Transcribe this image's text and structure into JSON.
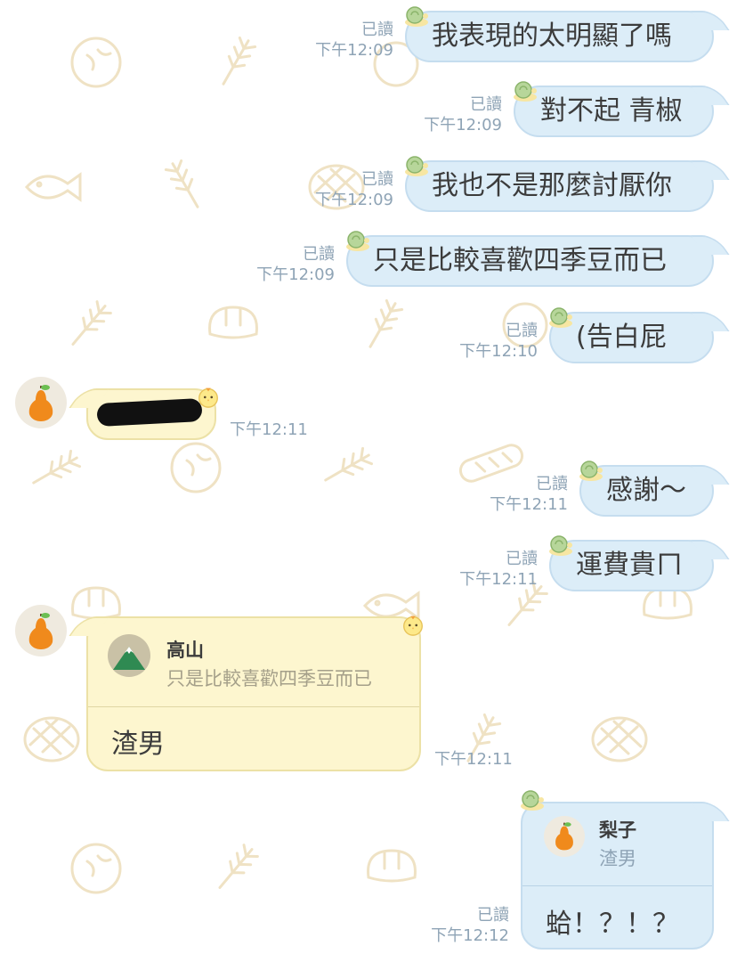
{
  "colors": {
    "outgoing_bubble": "#dcedf8",
    "incoming_bubble": "#fdf6cf",
    "meta_text": "#8fa4b6",
    "background_doodles": "#efe2c4"
  },
  "messages": [
    {
      "text": "我表現的太明顯了嗎",
      "read": "已讀",
      "time": "下午12:09"
    },
    {
      "text": "對不起 青椒",
      "read": "已讀",
      "time": "下午12:09"
    },
    {
      "text": "我也不是那麼討厭你",
      "read": "已讀",
      "time": "下午12:09"
    },
    {
      "text": "只是比較喜歡四季豆而已",
      "read": "已讀",
      "time": "下午12:09"
    },
    {
      "text": "(告白屁",
      "read": "已讀",
      "time": "下午12:10"
    },
    {
      "time": "下午12:11",
      "text_redacted": true
    },
    {
      "text": "感謝～",
      "read": "已讀",
      "time": "下午12:11"
    },
    {
      "text": "運費貴ㄇ",
      "read": "已讀",
      "time": "下午12:11"
    },
    {
      "reply_to_name": "高山",
      "reply_to_text": "只是比較喜歡四季豆而已",
      "text": "渣男",
      "time": "下午12:11"
    },
    {
      "reply_to_name": "梨子",
      "reply_to_text": "渣男",
      "text": "蛤！？！？",
      "read": "已讀",
      "time": "下午12:12"
    }
  ],
  "icons": {
    "sticker_decoration": "snail-icon",
    "incoming_decoration": "chick-icon",
    "contact_avatar": "pear-icon",
    "reply_avatar_mountain": "mountain-icon"
  }
}
